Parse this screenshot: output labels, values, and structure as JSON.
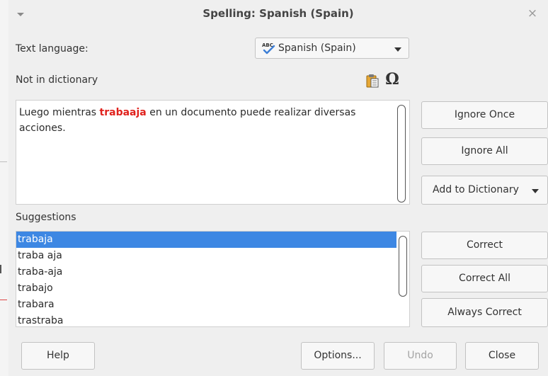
{
  "window": {
    "title": "Spelling: Spanish (Spain)",
    "close_glyph": "×",
    "menu_icon": "chevron-down-icon"
  },
  "language": {
    "label": "Text language:",
    "selected": "Spanish (Spain)",
    "icon": "spellcheck-abc-icon"
  },
  "not_in_dictionary": {
    "label": "Not in dictionary",
    "sentence_before": "Luego mientras ",
    "misspelled_word": "trabaaja",
    "sentence_after": " en un documento puede realizar diversas acciones.",
    "error_color": "#e0221d",
    "toolbar_icons": [
      "paste-icon",
      "special-character-omega-icon"
    ],
    "omega_glyph": "Ω"
  },
  "suggestions": {
    "label": "Suggestions",
    "items": [
      "trabaja",
      "traba aja",
      "traba-aja",
      "trabajo",
      "trabara",
      "trastraba"
    ],
    "selected": "trabaja",
    "selection_color": "#3d87e3"
  },
  "buttons": {
    "ignore_once": "Ignore Once",
    "ignore_all": "Ignore All",
    "add_to_dictionary": "Add to Dictionary",
    "correct": "Correct",
    "correct_all": "Correct All",
    "always_correct": "Always Correct",
    "help": "Help",
    "options": "Options...",
    "undo": "Undo",
    "close": "Close"
  }
}
